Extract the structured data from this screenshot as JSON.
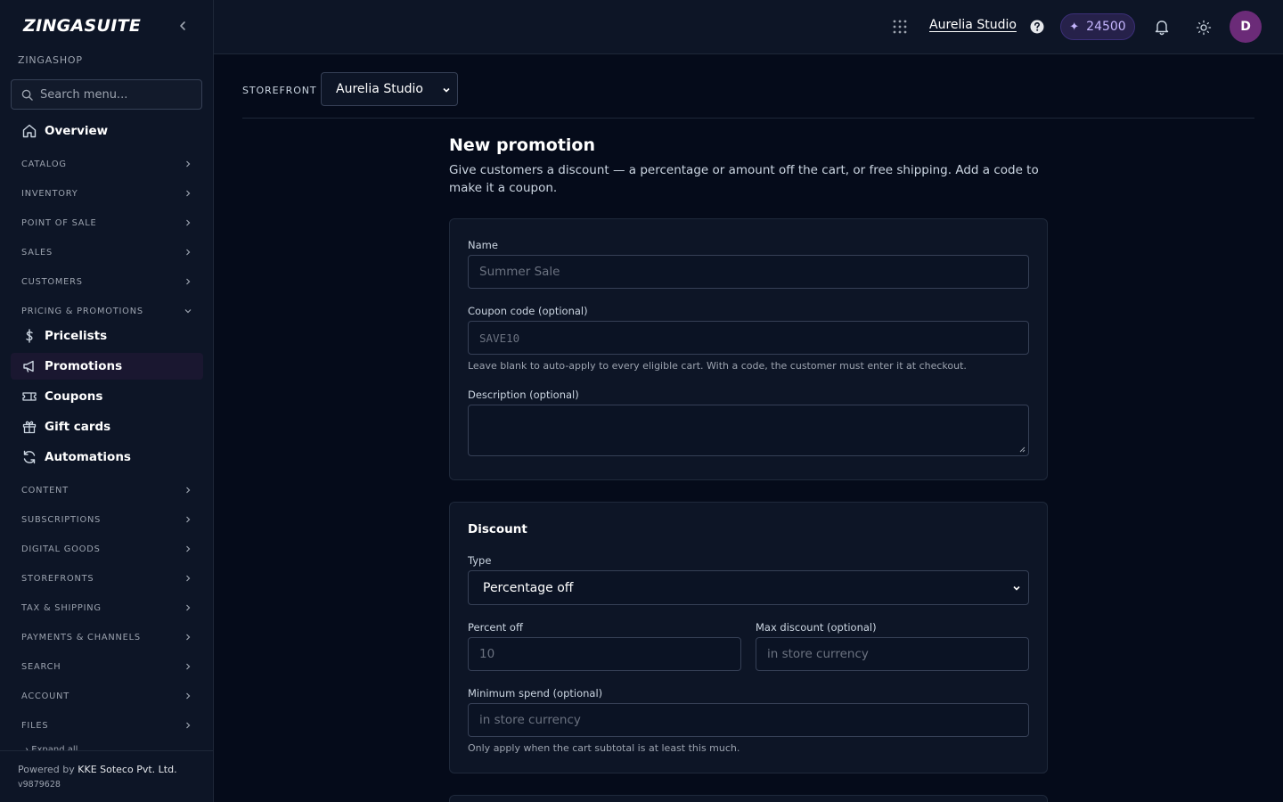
{
  "brand": {
    "logo": "ZINGASUITE",
    "workspace": "ZINGASHOP"
  },
  "search": {
    "placeholder": "Search menu..."
  },
  "sidebar": {
    "overview": "Overview",
    "groups_top": [
      "CATALOG",
      "INVENTORY",
      "POINT OF SALE",
      "SALES",
      "CUSTOMERS"
    ],
    "open_group": "PRICING & PROMOTIONS",
    "items": [
      {
        "label": "Pricelists",
        "icon": "dollar-icon"
      },
      {
        "label": "Promotions",
        "icon": "megaphone-icon",
        "active": true
      },
      {
        "label": "Coupons",
        "icon": "ticket-icon"
      },
      {
        "label": "Gift cards",
        "icon": "gift-icon"
      },
      {
        "label": "Automations",
        "icon": "refresh-icon"
      }
    ],
    "groups_bottom": [
      "CONTENT",
      "SUBSCRIPTIONS",
      "DIGITAL GOODS",
      "STOREFRONTS",
      "TAX & SHIPPING",
      "PAYMENTS & CHANNELS",
      "SEARCH",
      "ACCOUNT",
      "FILES"
    ],
    "expand_all": "Expand all",
    "footer": {
      "powered_by": "Powered by ",
      "company": "KKE Soteco Pvt. Ltd.",
      "version": "v9879628"
    }
  },
  "topbar": {
    "store_name": "Aurelia Studio",
    "credits": "24500",
    "avatar_initial": "D"
  },
  "storefront": {
    "label": "STOREFRONT",
    "selected": "Aurelia Studio"
  },
  "page": {
    "title": "New promotion",
    "description": "Give customers a discount — a percentage or amount off the cart, or free shipping. Add a code to make it a coupon."
  },
  "form": {
    "name": {
      "label": "Name",
      "placeholder": "Summer Sale",
      "value": ""
    },
    "coupon": {
      "label": "Coupon code (optional)",
      "placeholder": "SAVE10",
      "value": "",
      "help": "Leave blank to auto-apply to every eligible cart. With a code, the customer must enter it at checkout."
    },
    "description": {
      "label": "Description (optional)",
      "value": ""
    },
    "discount": {
      "heading": "Discount",
      "type_label": "Type",
      "type_value": "Percentage off",
      "percent": {
        "label": "Percent off",
        "placeholder": "10",
        "value": ""
      },
      "max": {
        "label": "Max discount (optional)",
        "placeholder": "in store currency",
        "value": ""
      },
      "min_spend": {
        "label": "Minimum spend (optional)",
        "placeholder": "in store currency",
        "value": "",
        "help": "Only apply when the cart subtotal is at least this much."
      }
    }
  },
  "colors": {
    "background": "#050b1a",
    "panel": "#0d1526",
    "accent": "#c4b5fd",
    "avatar": "#6b2b78"
  }
}
